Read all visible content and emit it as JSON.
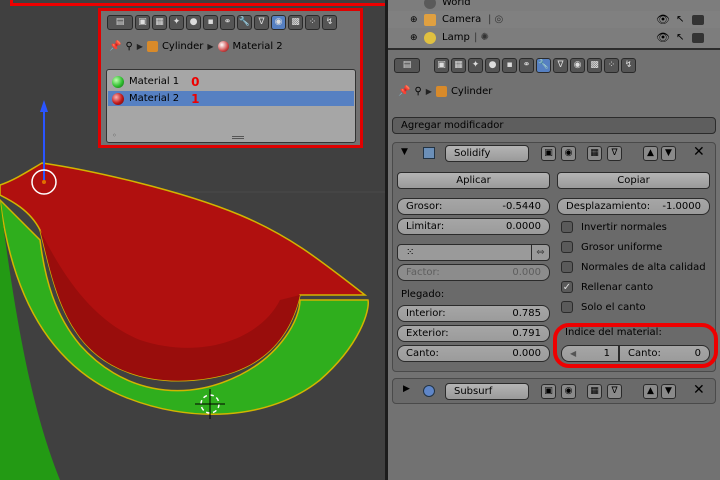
{
  "outliner": {
    "rows": [
      {
        "label": "World",
        "color": "#5a5a5a"
      },
      {
        "label": "Camera",
        "color": "#e0a040"
      },
      {
        "label": "Lamp",
        "color": "#e0c040"
      }
    ]
  },
  "material_panel": {
    "object": "Cylinder",
    "material": "Material 2",
    "slots": [
      {
        "name": "Material 1",
        "index": "0",
        "color": "#2fbf2f"
      },
      {
        "name": "Material 2",
        "index": "1",
        "color": "#c01818"
      }
    ]
  },
  "properties": {
    "object": "Cylinder",
    "add_modifier": "Agregar modificador",
    "solidify": {
      "name": "Solidify",
      "apply": "Aplicar",
      "copy": "Copiar",
      "thickness_label": "Grosor:",
      "thickness_value": "-0.5440",
      "offset_label": "Desplazamiento:",
      "offset_value": "-1.0000",
      "clamp_label": "Limitar:",
      "clamp_value": "0.0000",
      "factor_label": "Factor:",
      "factor_value": "0.000",
      "crease_title": "Plegado:",
      "inner_label": "Interior:",
      "inner_value": "0.785",
      "outer_label": "Exterior:",
      "outer_value": "0.791",
      "rim_label": "Canto:",
      "rim_value": "0.000",
      "flip_normals": "Invertir normales",
      "even_thickness": "Grosor uniforme",
      "hq_normals": "Normales de alta calidad",
      "fill_rim": "Rellenar canto",
      "only_rim": "Solo el canto",
      "material_index_title": "Índice del material:",
      "mat_index_value": "1",
      "rim_mat_label": "Canto:",
      "rim_mat_value": "0"
    },
    "subsurf": {
      "name": "Subsurf"
    }
  }
}
